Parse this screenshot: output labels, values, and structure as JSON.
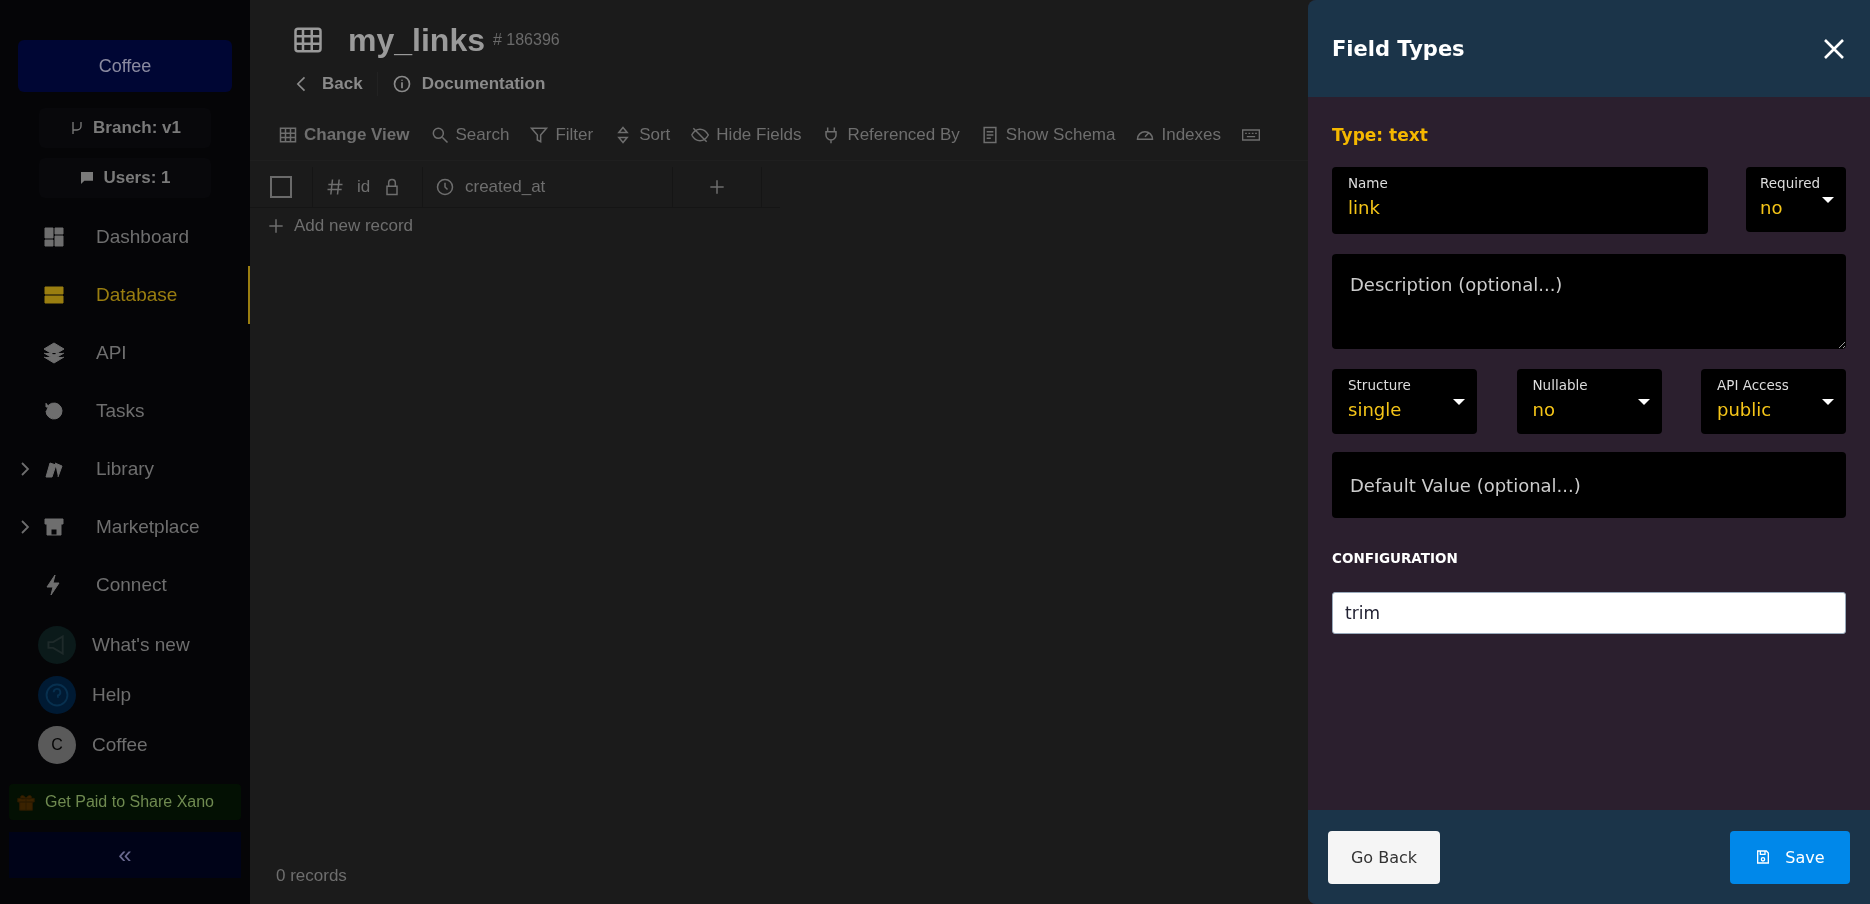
{
  "sidebar": {
    "workspace": "Coffee",
    "branch": "Branch: v1",
    "users": "Users: 1",
    "nav": [
      {
        "label": "Dashboard",
        "kind": "link",
        "selected": false
      },
      {
        "label": "Database",
        "kind": "link",
        "selected": true
      },
      {
        "label": "API",
        "kind": "link",
        "selected": false
      },
      {
        "label": "Tasks",
        "kind": "link",
        "selected": false
      },
      {
        "label": "Library",
        "kind": "group",
        "selected": false
      },
      {
        "label": "Marketplace",
        "kind": "group",
        "selected": false
      },
      {
        "label": "Connect",
        "kind": "link",
        "selected": false
      }
    ],
    "footer_items": [
      {
        "label": "What's new",
        "kind": "news"
      },
      {
        "label": "Help",
        "kind": "help"
      },
      {
        "label": "Coffee",
        "kind": "avatar",
        "avatar": "C"
      }
    ],
    "promo": "Get Paid to Share Xano",
    "collapse": "«"
  },
  "table": {
    "title": "my_links",
    "id": "# 186396",
    "back": "Back",
    "docs": "Documentation",
    "toolbar": [
      {
        "label": "Change View",
        "active": true
      },
      {
        "label": "Search",
        "active": false
      },
      {
        "label": "Filter",
        "active": false
      },
      {
        "label": "Sort",
        "active": false
      },
      {
        "label": "Hide Fields",
        "active": false
      },
      {
        "label": "Referenced By",
        "active": false
      },
      {
        "label": "Show Schema",
        "active": false
      },
      {
        "label": "Indexes",
        "active": false
      }
    ],
    "columns": [
      {
        "label": "id",
        "kind": "id"
      },
      {
        "label": "created_at",
        "kind": "timestamp"
      }
    ],
    "select_all": {
      "checked": false
    },
    "add_record": "Add new record",
    "record_count": "0 records"
  },
  "drawer": {
    "title": "Field Types",
    "type": "Type: text",
    "name": {
      "label": "Name",
      "value": "link"
    },
    "required": {
      "label": "Required",
      "value": "no"
    },
    "description": {
      "placeholder": "Description (optional...)"
    },
    "selects": [
      {
        "label": "Structure",
        "value": "single"
      },
      {
        "label": "Nullable",
        "value": "no"
      },
      {
        "label": "API Access",
        "value": "public"
      }
    ],
    "default_value": {
      "placeholder": "Default Value (optional...)"
    },
    "configuration": {
      "heading": "CONFIGURATION",
      "value": "trim"
    },
    "buttons": {
      "back": "Go Back",
      "save": "Save"
    }
  }
}
